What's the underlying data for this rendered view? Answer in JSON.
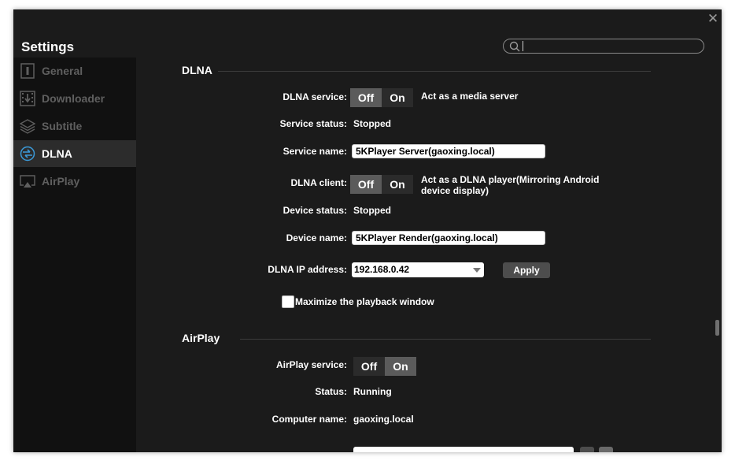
{
  "window": {
    "title": "Settings",
    "close": "✕"
  },
  "search": {
    "value": "",
    "placeholder": ""
  },
  "sidebar": {
    "items": [
      {
        "label": "General",
        "icon": "general-icon",
        "active": false
      },
      {
        "label": "Downloader",
        "icon": "downloader-icon",
        "active": false
      },
      {
        "label": "Subtitle",
        "icon": "subtitle-icon",
        "active": false
      },
      {
        "label": "DLNA",
        "icon": "dlna-icon",
        "active": true
      },
      {
        "label": "AirPlay",
        "icon": "airplay-icon",
        "active": false
      }
    ]
  },
  "dlna": {
    "heading": "DLNA",
    "service_label": "DLNA service:",
    "service_off": "Off",
    "service_on": "On",
    "service_selected": "Off",
    "service_desc": "Act as a media server",
    "status_label": "Service status:",
    "status_value": "Stopped",
    "name_label": "Service name:",
    "name_value": "5KPlayer Server(gaoxing.local)",
    "client_label": "DLNA client:",
    "client_off": "Off",
    "client_on": "On",
    "client_selected": "Off",
    "client_desc": "Act as a DLNA player(Mirroring Android device display)",
    "device_status_label": "Device status:",
    "device_status_value": "Stopped",
    "device_name_label": "Device name:",
    "device_name_value": "5KPlayer Render(gaoxing.local)",
    "ip_label": "DLNA IP address:",
    "ip_value": "192.168.0.42",
    "apply_label": "Apply",
    "maximize_label": "Maximize the playback window",
    "maximize_checked": false
  },
  "airplay": {
    "heading": "AirPlay",
    "service_label": "AirPlay service:",
    "service_off": "Off",
    "service_on": "On",
    "service_selected": "On",
    "status_label": "Status:",
    "status_value": "Running",
    "computer_label": "Computer name:",
    "computer_value": "gaoxing.local"
  },
  "colors": {
    "background": "#1b1b1b",
    "sidebar": "#111111",
    "accent_icon": "#3b9ad9"
  }
}
